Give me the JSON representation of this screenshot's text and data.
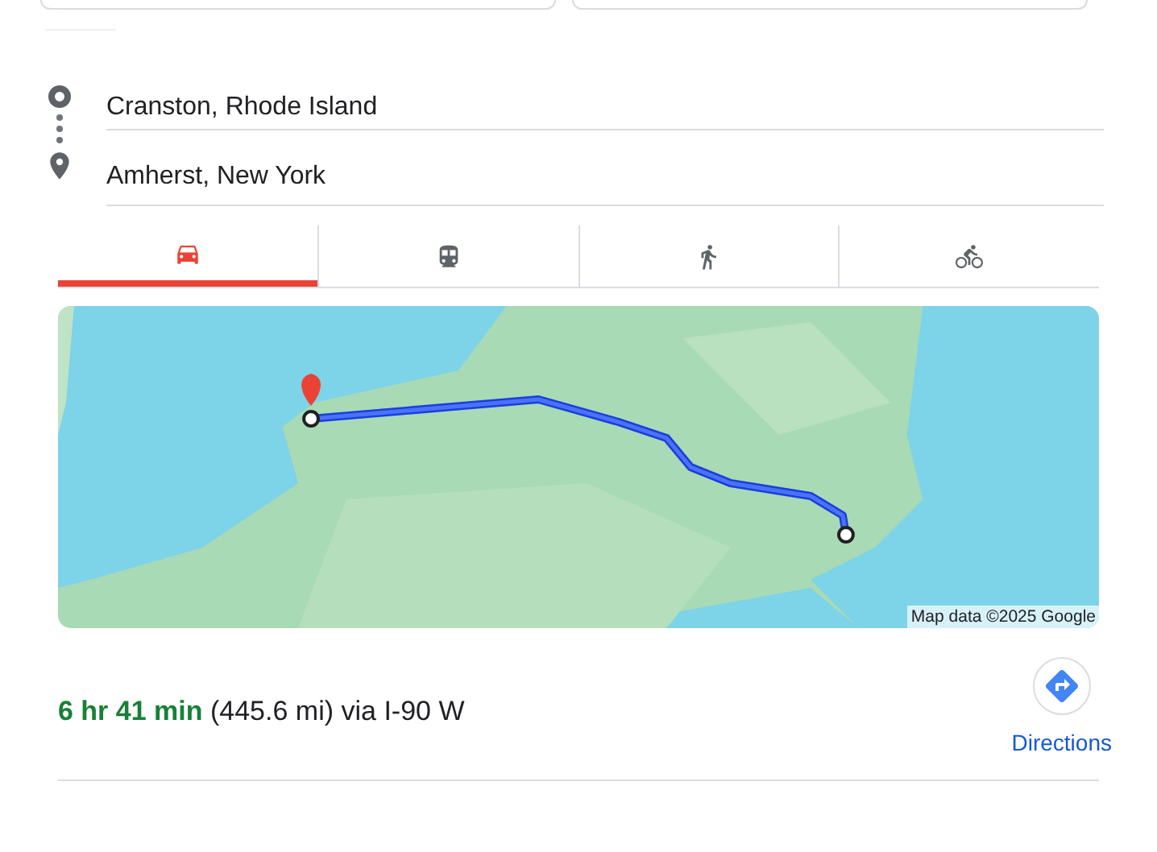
{
  "route": {
    "origin": "Cranston, Rhode Island",
    "destination": "Amherst, New York"
  },
  "modes": [
    {
      "kind": "car",
      "selected": true
    },
    {
      "kind": "transit",
      "selected": false
    },
    {
      "kind": "walk",
      "selected": false
    },
    {
      "kind": "bike",
      "selected": false
    }
  ],
  "map": {
    "attribution": "Map data ©2025 Google"
  },
  "summary": {
    "text": "**6 hr 41 min** (445.6 mi) via I-90 W"
  },
  "directions_button": {
    "label": "Directions"
  }
}
